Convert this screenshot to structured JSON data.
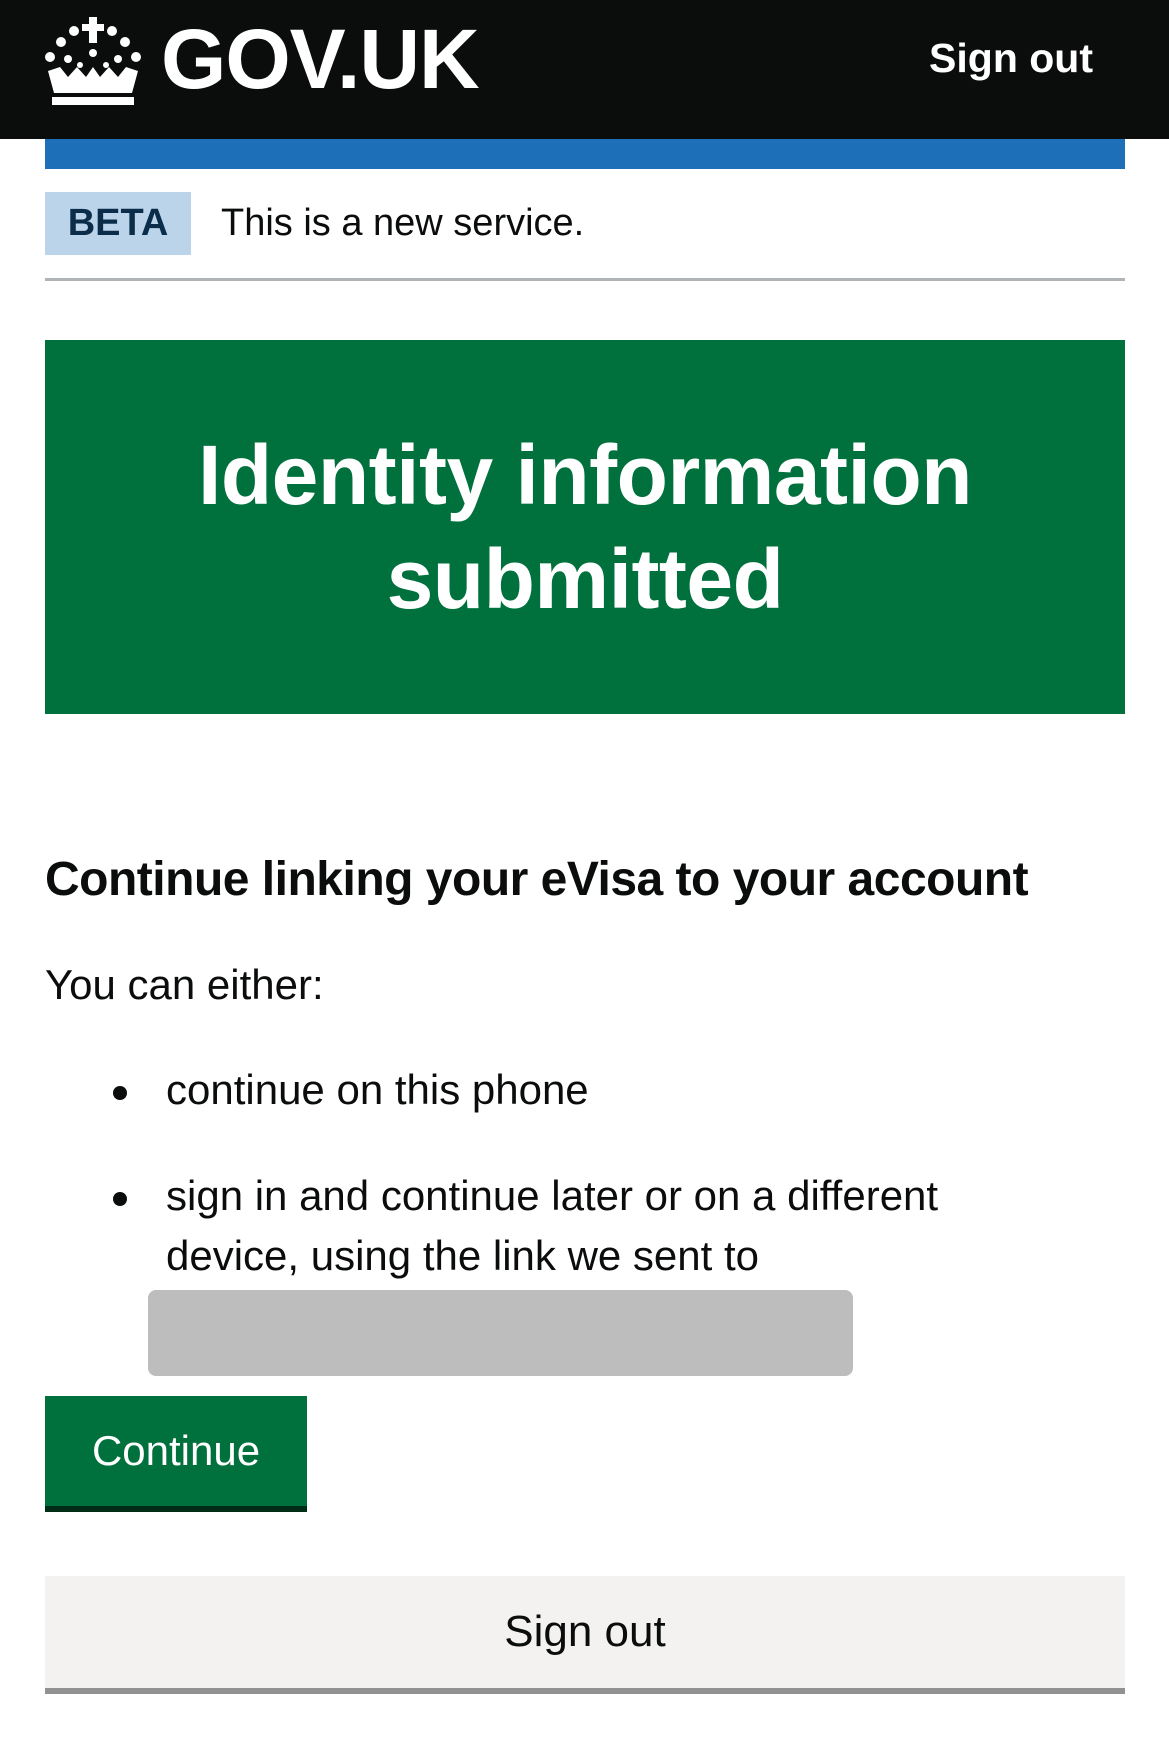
{
  "header": {
    "logo_text": "GOV.UK",
    "sign_out_label": "Sign out"
  },
  "phase_banner": {
    "tag": "BETA",
    "text": "This is a new service."
  },
  "panel": {
    "title": "Identity information submitted"
  },
  "content": {
    "heading": "Continue linking your eVisa to your account",
    "intro": "You can either:",
    "options": [
      "continue on this phone",
      "sign in and continue later or on a different device, using the link we sent to"
    ]
  },
  "buttons": {
    "continue_label": "Continue",
    "sign_out_label": "Sign out"
  },
  "colors": {
    "header_bg": "#0b0c0c",
    "brand_blue": "#1d70b8",
    "success_green": "#00703c",
    "beta_tag_bg": "#bbd4ea",
    "secondary_button_bg": "#f3f2f1"
  },
  "icons": {
    "logo": "crown-icon"
  }
}
